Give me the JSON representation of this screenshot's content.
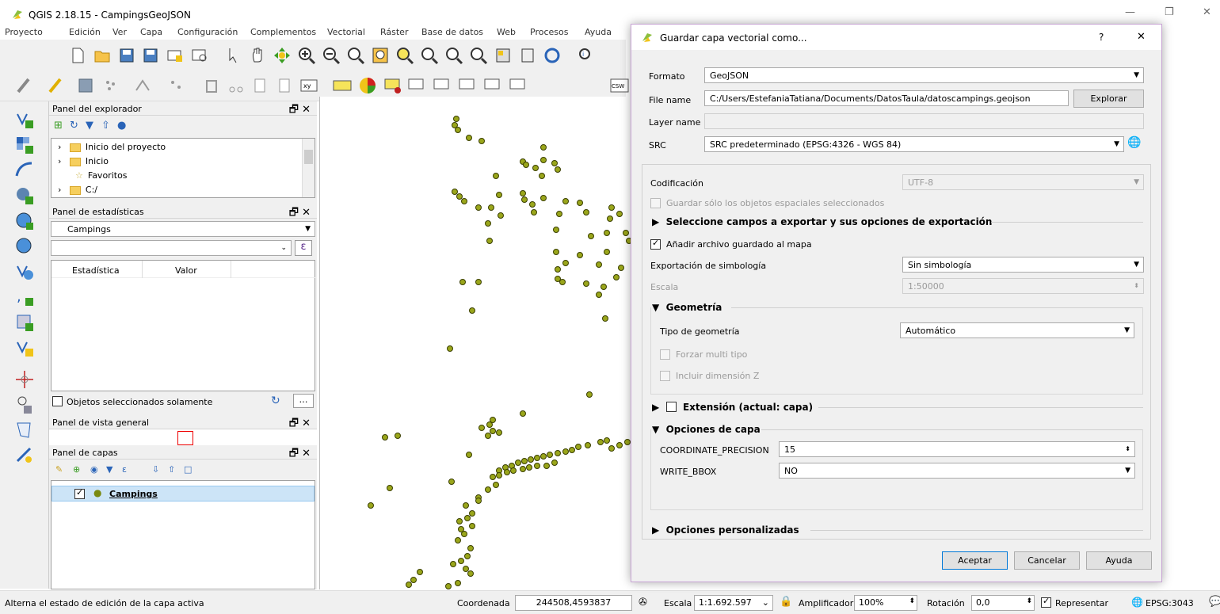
{
  "window": {
    "title": "QGIS 2.18.15 - CampingsGeoJSON"
  },
  "menu": [
    "Proyecto",
    "Edición",
    "Ver",
    "Capa",
    "Configuración",
    "Complementos",
    "Vectorial",
    "Ráster",
    "Base de datos",
    "Web",
    "Procesos",
    "Ayuda"
  ],
  "browser_panel": {
    "title": "Panel del explorador",
    "items": [
      {
        "label": "Inicio del proyecto",
        "icon": "folder-icon"
      },
      {
        "label": "Inicio",
        "icon": "folder-icon"
      },
      {
        "label": "Favoritos",
        "icon": "star-icon"
      },
      {
        "label": "C:/",
        "icon": "folder-icon"
      }
    ]
  },
  "stats_panel": {
    "title": "Panel de estadísticas",
    "layer": "Campings",
    "col_stat": "Estadística",
    "col_value": "Valor",
    "selected_only": "Objetos seleccionados solamente"
  },
  "overview_panel": {
    "title": "Panel de vista general"
  },
  "layers_panel": {
    "title": "Panel de capas",
    "layer": "Campings"
  },
  "status": {
    "message": "Alterna el estado de edición de la capa activa",
    "coord_label": "Coordenada",
    "coord_value": "244508,4593837",
    "scale_label": "Escala",
    "scale_value": "1:1.692.597",
    "magnifier_label": "Amplificador",
    "magnifier_value": "100%",
    "rotation_label": "Rotación",
    "rotation_value": "0,0",
    "render_label": "Representar",
    "crs": "EPSG:3043"
  },
  "dialog": {
    "title": "Guardar capa vectorial como...",
    "help": "?",
    "close": "✕",
    "format_label": "Formato",
    "format_value": "GeoJSON",
    "filename_label": "File name",
    "filename_value": "C:/Users/EstefaniaTatiana/Documents/DatosTaula/datoscampings.geojson",
    "browse": "Explorar",
    "layername_label": "Layer name",
    "layername_value": "",
    "crs_label": "SRC",
    "crs_value": "SRC predeterminado (EPSG:4326 - WGS 84)",
    "encoding_label": "Codificación",
    "encoding_value": "UTF-8",
    "save_selected": "Guardar sólo los objetos espaciales seleccionados",
    "select_fields": "Seleccione campos a exportar y sus opciones de exportación",
    "add_to_map": "Añadir archivo guardado al mapa",
    "symbology_label": "Exportación de simbología",
    "symbology_value": "Sin simbología",
    "scale_label": "Escala",
    "scale_value": "1:50000",
    "geometry_section": "Geometría",
    "geomtype_label": "Tipo de geometría",
    "geomtype_value": "Automático",
    "force_multi": "Forzar multi tipo",
    "include_z": "Incluir dimensión Z",
    "extent_section": "Extensión (actual: capa)",
    "layer_options": "Opciones de capa",
    "opt1_label": "COORDINATE_PRECISION",
    "opt1_value": "15",
    "opt2_label": "WRITE_BBOX",
    "opt2_value": "NO",
    "custom_options": "Opciones personalizadas",
    "ok": "Aceptar",
    "cancel": "Cancelar",
    "help_btn": "Ayuda"
  },
  "colors": {
    "point_fill": "#9aa61b",
    "point_stroke": "#3a3f00",
    "dialog_border": "#c8a5d4",
    "accent": "#0078d7"
  }
}
